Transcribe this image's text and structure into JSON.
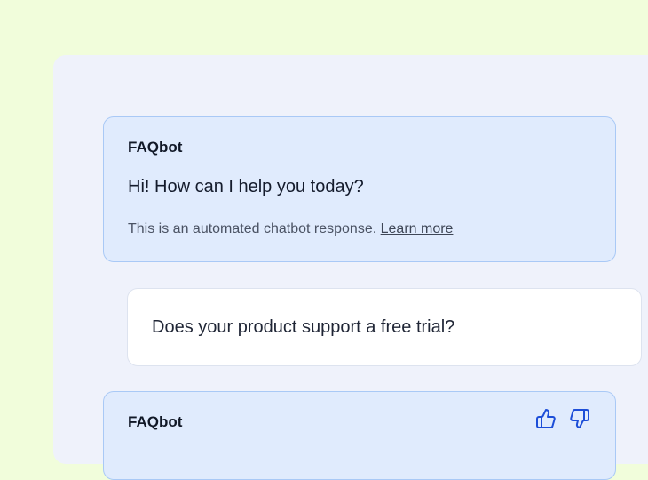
{
  "messages": [
    {
      "sender": "FAQbot",
      "text": "Hi! How can I help you today?",
      "disclaimer": "This is an automated chatbot response.",
      "learn_more_label": "Learn more"
    },
    {
      "text": "Does your product support a free trial?"
    },
    {
      "sender": "FAQbot"
    }
  ],
  "feedback": {
    "thumbs_up_icon": "thumbs-up-icon",
    "thumbs_down_icon": "thumbs-down-icon",
    "icon_color": "#1d4ed8"
  },
  "colors": {
    "page_background": "#f1fddb",
    "panel_background": "#eff2fb",
    "bot_bubble_background": "#e0ebfd",
    "bot_bubble_border": "#a9c9f6",
    "user_bubble_background": "#ffffff"
  }
}
